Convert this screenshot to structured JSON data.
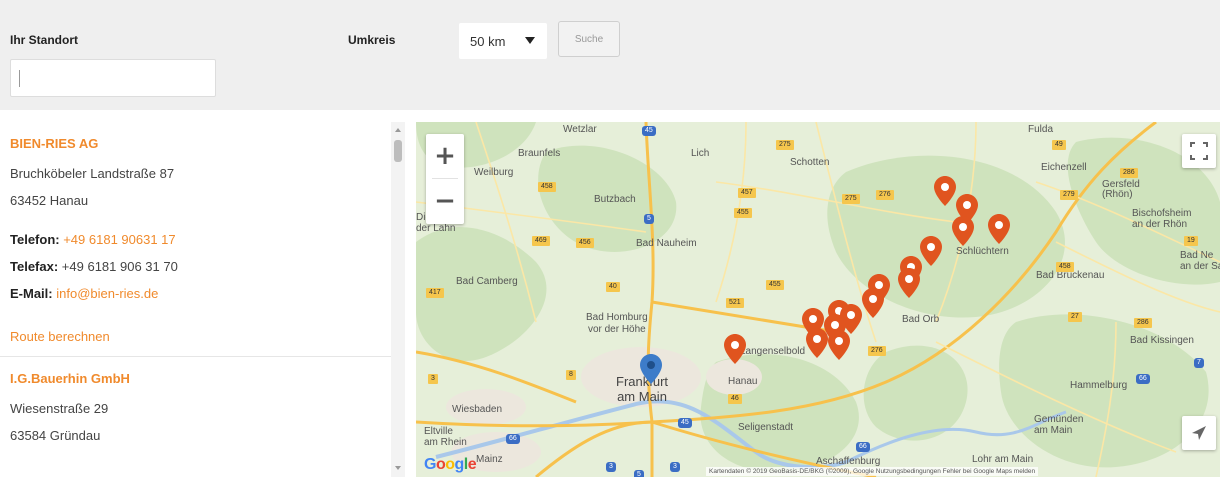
{
  "search": {
    "location_label": "Ihr Standort",
    "location_value": "",
    "radius_label": "Umkreis",
    "radius_selected": "50 km",
    "search_button": "Suche"
  },
  "dealers": [
    {
      "name": "BIEN-RIES AG",
      "street": "Bruchköbeler Landstraße 87",
      "city": "63452 Hanau",
      "phone_label": "Telefon:",
      "phone": "+49 6181 90631 17",
      "fax_label": "Telefax:",
      "fax": "+49 6181 906 31 70",
      "email_label": "E-Mail:",
      "email": "info@bien-ries.de",
      "route_label": "Route berechnen"
    },
    {
      "name": "I.G.Bauerhin GmbH",
      "street": "Wiesenstraße 29",
      "city": "63584 Gründau"
    }
  ],
  "map": {
    "zoom_in": "+",
    "zoom_out": "−",
    "google_logo": "Google",
    "attribution": "Kartendaten © 2019 GeoBasis-DE/BKG (©2009), Google   Nutzungsbedingungen   Fehler bei Google Maps melden",
    "icons": {
      "fullscreen": "fullscreen-icon",
      "locate": "locate-icon",
      "dealer_marker": "map-pin-icon",
      "user_marker": "user-location-pin-icon"
    },
    "colors": {
      "dealer_marker": "#e0541f",
      "user_marker": "#3d7cc9",
      "accent_text": "#f08a2c"
    },
    "places": {
      "wetzlar": "Wetzlar",
      "fulda": "Fulda",
      "braunfels": "Braunfels",
      "weilburg": "Weilburg",
      "lich": "Lich",
      "schotten": "Schotten",
      "butzbach": "Butzbach",
      "badnauheim": "Bad Nauheim",
      "badcamberg": "Bad Camberg",
      "badhomburg": "Bad Homburg\nvor der Höhe",
      "frankfurt": "Frankfurt\nam Main",
      "hanau": "Hanau",
      "langenselbold": "Langenselbold",
      "wiesbaden": "Wiesbaden",
      "eltville": "Eltville\nam Rhein",
      "seligenstadt": "Seligenstadt",
      "badorb": "Bad Orb",
      "badbrueckenau": "Bad Brückenau",
      "badkissingen": "Bad Kissingen",
      "hammelburg": "Hammelburg",
      "gemuenden": "Gemünden\nam Main",
      "lohr": "Lohr am Main",
      "aschaffenburg": "Aschaffenburg",
      "mainz": "Mainz",
      "gersfeld": "Gersfeld\n(Rhön)",
      "bischofsheim": "Bischofsheim\nan der Rhön",
      "badneustadt": "Bad Ne\nan der Saa",
      "eichenzell": "Eichenzell",
      "schluechtern": "Schlüchtern",
      "diezanderlahn": "Diez an\nder Lahn"
    },
    "shields": [
      "45",
      "49",
      "5",
      "5",
      "66",
      "3",
      "45",
      "7",
      "66",
      "3",
      "275",
      "275",
      "276",
      "457",
      "455",
      "458",
      "276",
      "455",
      "417",
      "521",
      "456",
      "40",
      "3",
      "27",
      "279",
      "286",
      "19",
      "286",
      "458",
      "469",
      "8",
      "46",
      "66"
    ]
  }
}
